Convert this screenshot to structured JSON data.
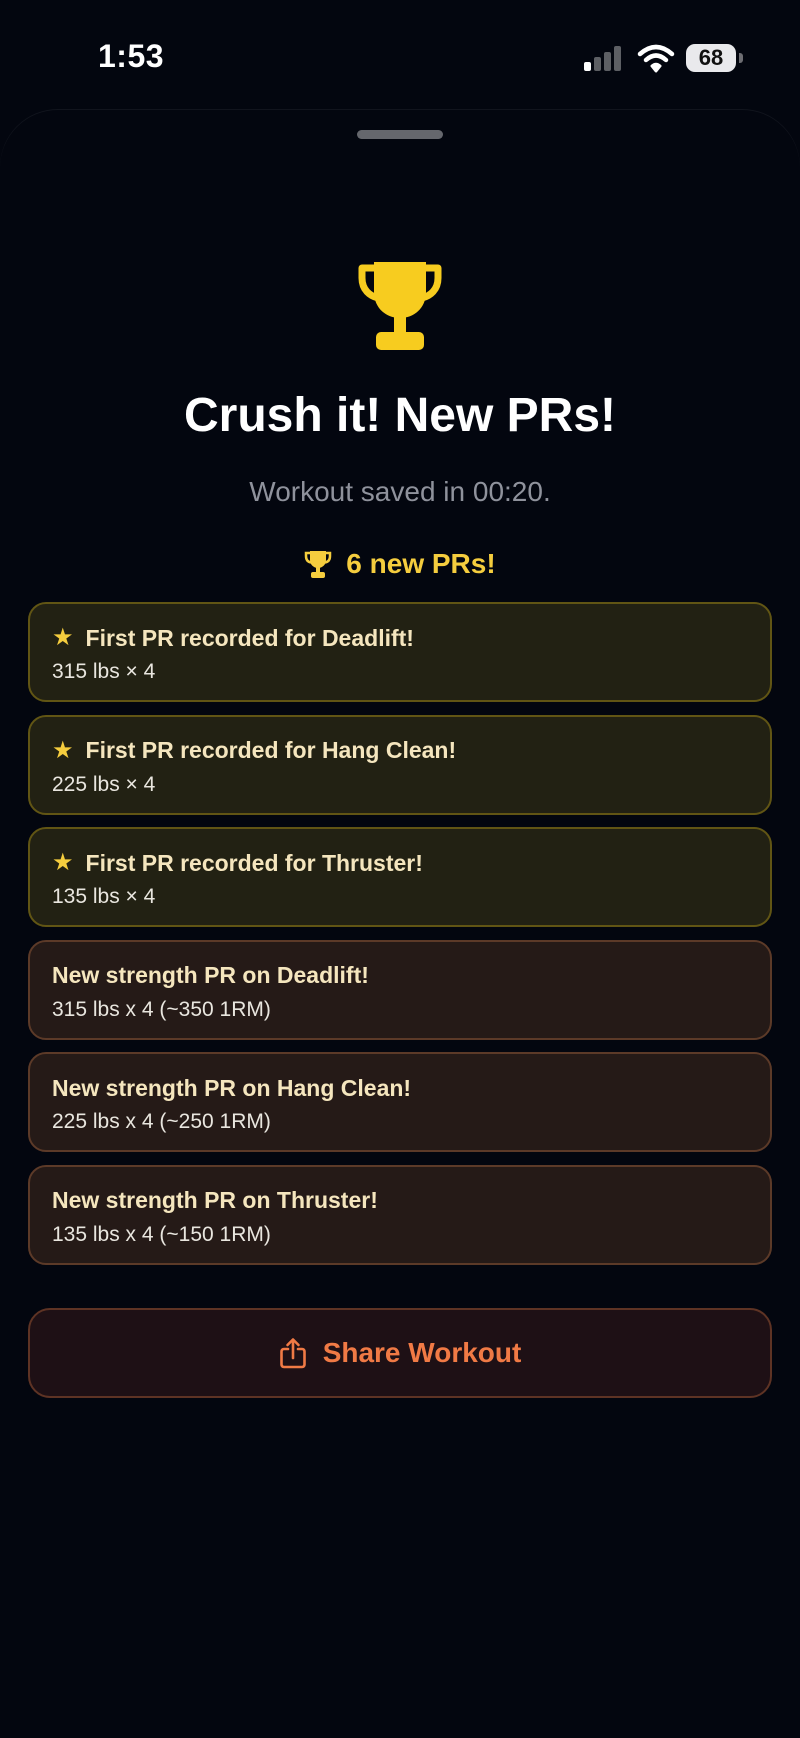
{
  "status_bar": {
    "time": "1:53",
    "battery": "68",
    "icons": [
      "signal-icon",
      "wifi-icon",
      "battery-icon"
    ]
  },
  "sheet": {
    "hero_icon": "trophy-icon",
    "title": "Crush it! New PRs!",
    "subtitle": "Workout saved in 00:20.",
    "pr_count_label": "6 new PRs!",
    "pr_items": [
      {
        "kind": "first",
        "title": "First PR recorded for Deadlift!",
        "detail": "315 lbs × 4"
      },
      {
        "kind": "first",
        "title": "First PR recorded for Hang Clean!",
        "detail": "225 lbs × 4"
      },
      {
        "kind": "first",
        "title": "First PR recorded for Thruster!",
        "detail": "135 lbs × 4"
      },
      {
        "kind": "strength",
        "title": "New strength PR on Deadlift!",
        "detail": "315 lbs x 4 (~350 1RM)"
      },
      {
        "kind": "strength",
        "title": "New strength PR on Hang Clean!",
        "detail": "225 lbs x 4 (~250 1RM)"
      },
      {
        "kind": "strength",
        "title": "New strength PR on Thruster!",
        "detail": "135 lbs x 4 (~150 1RM)"
      }
    ],
    "share_button_label": "Share Workout"
  },
  "colors": {
    "background": "#03060f",
    "gold": "#f5cd3e",
    "accent_orange": "#f07a45",
    "first_pr_card": "#222113",
    "strength_pr_card": "#251a17"
  }
}
